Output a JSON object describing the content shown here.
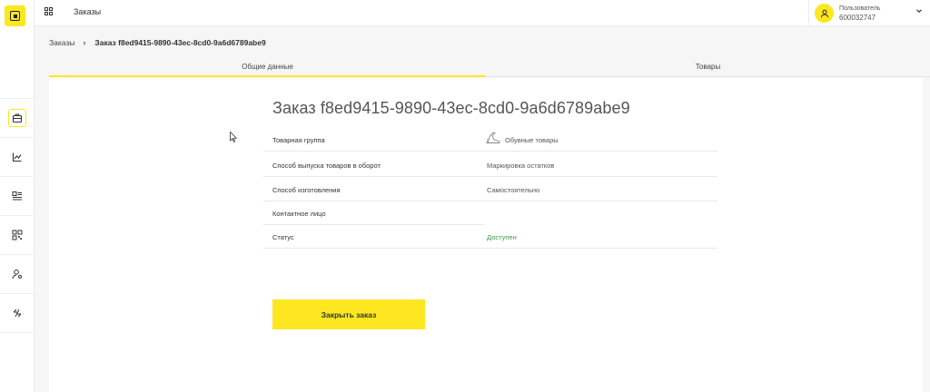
{
  "header": {
    "title": "Заказы",
    "user_label": "Пользователь",
    "user_id": "600032747"
  },
  "sidebar": {
    "items": [
      {
        "icon": "briefcase-icon",
        "active": true
      },
      {
        "icon": "chart-icon",
        "active": false
      },
      {
        "icon": "list-icon",
        "active": false
      },
      {
        "icon": "qr-grid-icon",
        "active": false
      },
      {
        "icon": "user-settings-icon",
        "active": false
      },
      {
        "icon": "transfer-icon",
        "active": false
      }
    ]
  },
  "breadcrumb": {
    "parent": "Заказы",
    "separator": "›",
    "current": "Заказ f8ed9415-9890-43ec-8cd0-9a6d6789abe9"
  },
  "tabs": [
    {
      "label": "Общие данные",
      "active": true
    },
    {
      "label": "Товары",
      "active": false
    }
  ],
  "order": {
    "title": "Заказ f8ed9415-9890-43ec-8cd0-9a6d6789abe9",
    "fields": [
      {
        "label": "Товарная группа",
        "value": "Обувные товары"
      },
      {
        "label": "Способ выпуска товаров в оборот",
        "value": "Маркировка остатков"
      },
      {
        "label": "Способ изготовления",
        "value": "Самостоятельно"
      },
      {
        "label": "Контактное лицо",
        "value": ""
      },
      {
        "label": "Статус",
        "value": "Доступен"
      }
    ],
    "close_button": "Закрыть заказ"
  },
  "colors": {
    "accent": "#fde720",
    "status_ok": "#3f9a4e",
    "background": "#f6f6f6"
  }
}
